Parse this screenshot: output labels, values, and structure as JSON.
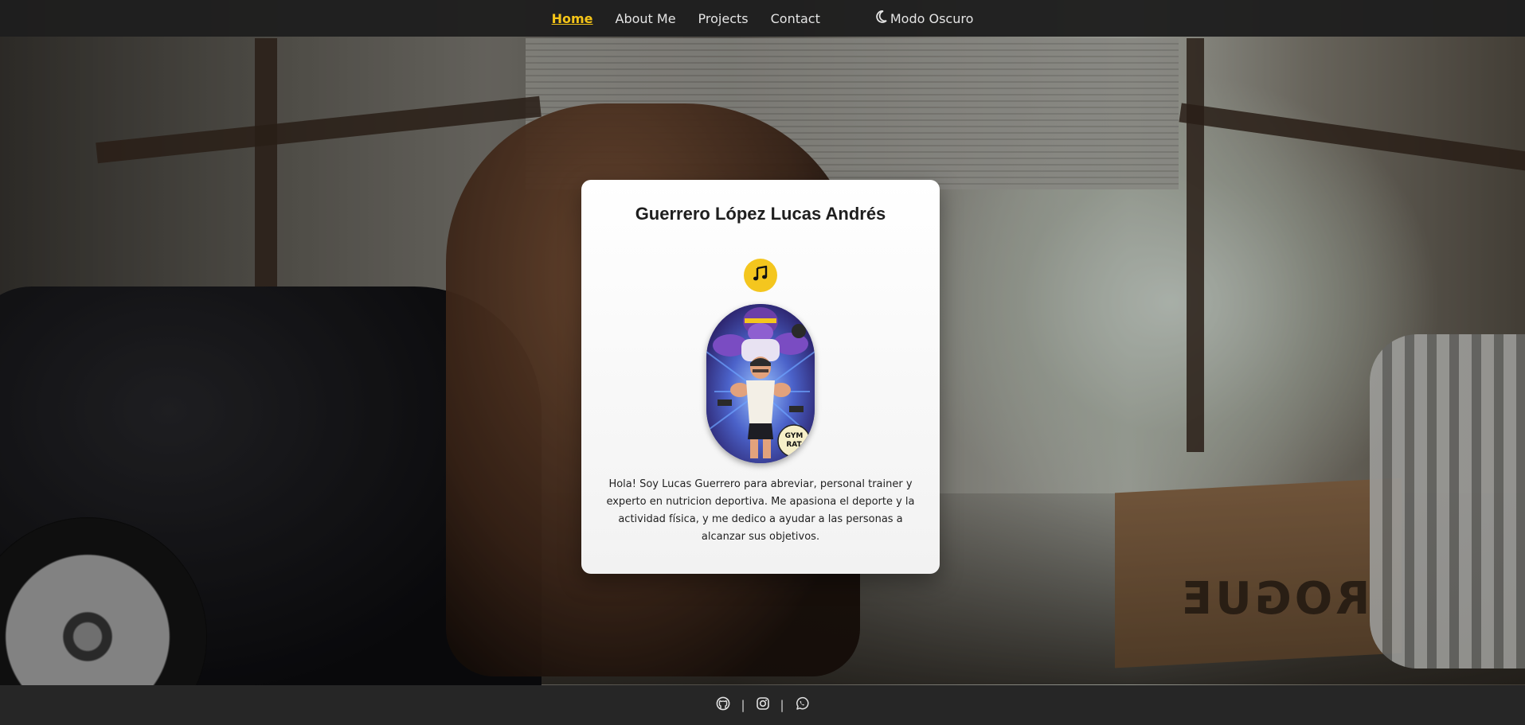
{
  "nav": {
    "items": [
      {
        "label": "Home",
        "active": true
      },
      {
        "label": "About Me",
        "active": false
      },
      {
        "label": "Projects",
        "active": false
      },
      {
        "label": "Contact",
        "active": false
      }
    ],
    "theme_toggle": {
      "icon": "moon-icon",
      "label": "Modo Oscuro"
    }
  },
  "card": {
    "title": "Guerrero López Lucas Andrés",
    "music_button_icon": "music-note-icon",
    "avatar": {
      "badge_text": "GYM RAT"
    },
    "bio": "Hola! Soy Lucas Guerrero para abreviar, personal trainer y experto en nutricion deportiva. Me apasiona el deporte y la actividad física, y me dedico a ayudar a las personas a alcanzar sus objetivos."
  },
  "background": {
    "box_label": "ROGUE"
  },
  "footer": {
    "links": [
      {
        "icon": "github-icon"
      },
      {
        "icon": "instagram-icon"
      },
      {
        "icon": "whatsapp-icon"
      }
    ],
    "separator": "|"
  },
  "colors": {
    "accent": "#f5c518",
    "nav_bg": "#1e1e1e",
    "footer_bg": "#262626",
    "card_bg": "#ffffff"
  }
}
